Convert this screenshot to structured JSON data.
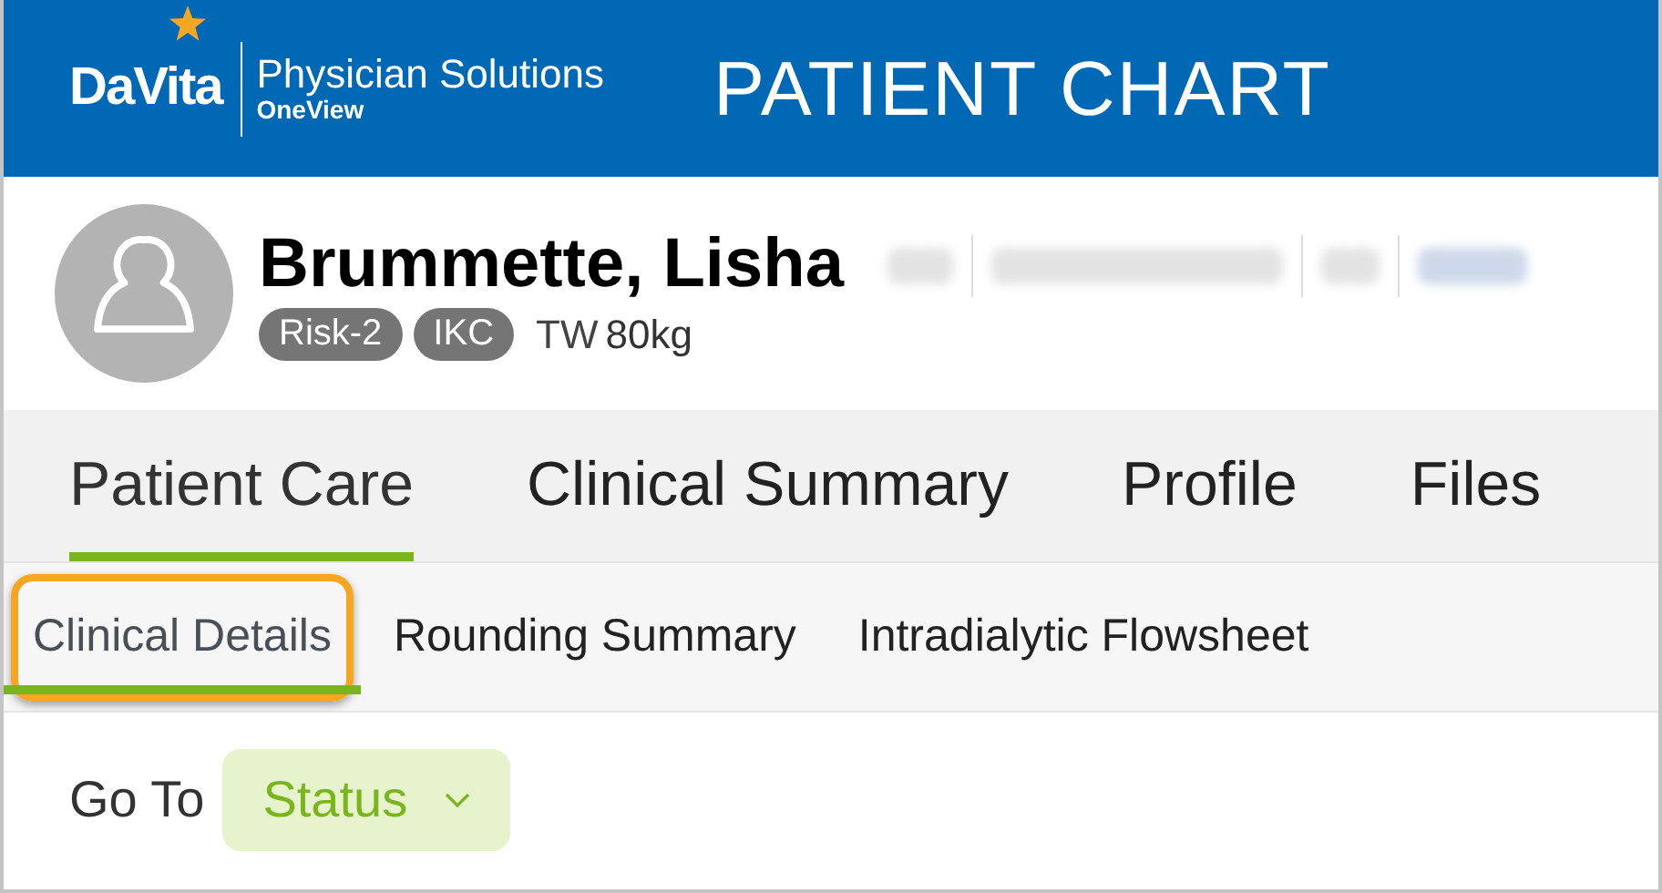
{
  "header": {
    "brand": "DaVita",
    "product": "Physician Solutions",
    "edition": "OneView",
    "title": "PATIENT CHART"
  },
  "patient": {
    "name": "Brummette, Lisha",
    "badges": [
      "Risk-2",
      "IKC"
    ],
    "weight_label": "TW",
    "weight": "80kg"
  },
  "tabs": [
    {
      "label": "Patient Care",
      "selected": true
    },
    {
      "label": "Clinical Summary",
      "selected": false
    },
    {
      "label": "Profile",
      "selected": false
    },
    {
      "label": "Files",
      "selected": false
    }
  ],
  "subtabs": [
    {
      "label": "Clinical Details",
      "selected": true,
      "highlighted": true
    },
    {
      "label": "Rounding Summary",
      "selected": false,
      "highlighted": false
    },
    {
      "label": "Intradialytic Flowsheet",
      "selected": false,
      "highlighted": false
    }
  ],
  "goto": {
    "label": "Go To",
    "value": "Status"
  }
}
